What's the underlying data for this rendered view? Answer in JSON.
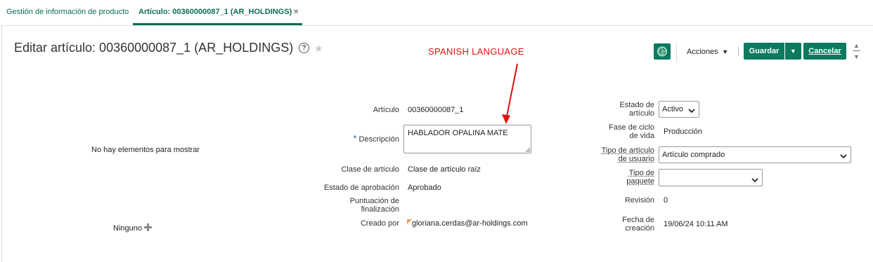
{
  "tabs": [
    {
      "label": "Gestión de información de producto"
    },
    {
      "label": "Artículo: 00360000087_1 (AR_HOLDINGS)"
    }
  ],
  "header": {
    "title": "Editar artículo: 00360000087_1 (AR_HOLDINGS)",
    "help_icon": "question-circle-icon",
    "favorite_icon": "star-icon"
  },
  "annotation": {
    "text": "SPANISH LANGUAGE",
    "color": "#e01010"
  },
  "toolbar": {
    "actions_label": "Acciones",
    "save_label": "Guardar",
    "cancel_label": "Cancelar",
    "accent": "#0b7a5f"
  },
  "left_panel": {
    "empty_message": "No hay elementos para mostrar",
    "none_label": "Ninguno"
  },
  "form": {
    "articulo_label": "Artículo",
    "articulo_value": "00360000087_1",
    "required_mark": "*",
    "descripcion_label": "Descripción",
    "descripcion_value": "HABLADOR OPALINA MATE",
    "clase_label": "Clase de artículo",
    "clase_value": "Clase de artículo raíz",
    "aprobacion_label": "Estado de aprobación",
    "aprobacion_value": "Aprobado",
    "puntuacion_label_1": "Puntuación de",
    "puntuacion_label_2": "finalización",
    "creado_label": "Creado por",
    "creado_value": "gloriana.cerdas@ar-holdings.com",
    "estado_label_1": "Estado de",
    "estado_label_2": "artículo",
    "estado_value": "Activo",
    "fase_label_1": "Fase de ciclo",
    "fase_label_2": "de vida",
    "fase_value": "Producción",
    "tipo_usuario_label_1": "Tipo de artículo",
    "tipo_usuario_label_2": "de usuario",
    "tipo_usuario_value": "Artículo comprado",
    "tipo_paquete_label_1": "Tipo de",
    "tipo_paquete_label_2": "paquete",
    "tipo_paquete_value": "",
    "revision_label": "Revisión",
    "revision_value": "0",
    "fecha_label_1": "Fecha de",
    "fecha_label_2": "creación",
    "fecha_value": "19/06/24 10:11 AM"
  }
}
